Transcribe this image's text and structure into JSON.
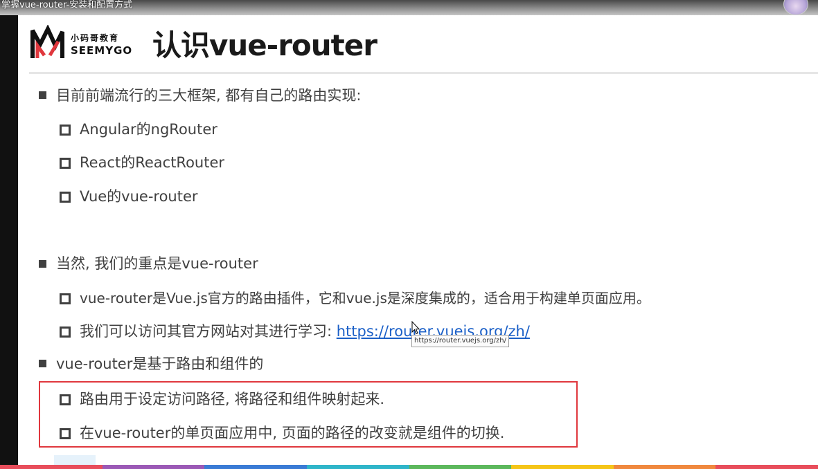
{
  "video": {
    "title": "掌握vue-router-安装和配置方式"
  },
  "logo": {
    "cn": "小码哥教育",
    "en": "SEEMYGO"
  },
  "slide": {
    "title": "认识vue-router",
    "bullets": [
      {
        "text": "目前前端流行的三大框架, 都有自己的路由实现:",
        "items": [
          "Angular的ngRouter",
          "React的ReactRouter",
          "Vue的vue-router"
        ]
      },
      {
        "text": "当然, 我们的重点是vue-router",
        "items": [
          "vue-router是Vue.js官方的路由插件，它和vue.js是深度集成的，适合用于构建单页面应用。",
          "我们可以访问其官方网站对其进行学习: "
        ],
        "link": "https://router.vuejs.org/zh/"
      },
      {
        "text": "vue-router是基于路由和组件的",
        "items": [
          "路由用于设定访问路径, 将路径和组件映射起来.",
          "在vue-router的单页面应用中, 页面的路径的改变就是组件的切换."
        ]
      }
    ]
  },
  "tooltip": {
    "text": "https://router.vuejs.org/zh/"
  },
  "colors": {
    "highlight_box": "#e0373d",
    "link": "#1a5fc7",
    "bottom_bar": [
      "#e84d5b",
      "#9b59b6",
      "#3a7bd5",
      "#2fb5c9",
      "#5cb85c",
      "#f5c518",
      "#f0883e",
      "#e84d5b"
    ]
  }
}
